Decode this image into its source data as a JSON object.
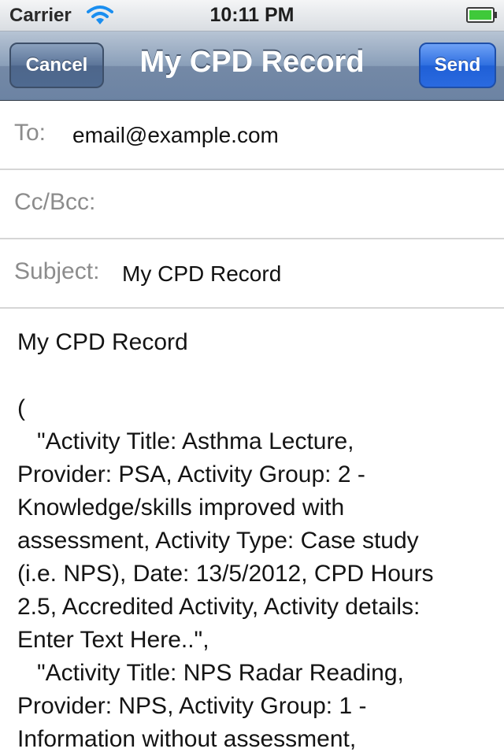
{
  "status_bar": {
    "carrier": "Carrier",
    "time": "10:11 PM",
    "wifi_icon": "wifi-icon",
    "battery_icon": "battery-icon",
    "battery_color": "#3fc93a"
  },
  "nav_bar": {
    "title": "My CPD Record",
    "cancel_label": "Cancel",
    "send_label": "Send",
    "send_color": "#2a6ae0"
  },
  "fields": {
    "to_label": "To:",
    "to_value": "email@example.com",
    "cc_label": "Cc/Bcc:",
    "cc_value": "",
    "subject_label": "Subject:",
    "subject_value": "My CPD Record"
  },
  "body": {
    "heading": "My CPD Record",
    "lines": [
      "(",
      "   \"Activity Title: Asthma Lecture,",
      "Provider: PSA, Activity Group: 2 -",
      "Knowledge/skills improved with",
      "assessment, Activity Type: Case study",
      "(i.e. NPS), Date: 13/5/2012, CPD Hours",
      "2.5, Accredited Activity, Activity details:",
      "Enter Text Here..\",",
      "   \"Activity Title: NPS Radar Reading,",
      "Provider: NPS, Activity Group: 1 -",
      "Information without assessment,"
    ]
  }
}
